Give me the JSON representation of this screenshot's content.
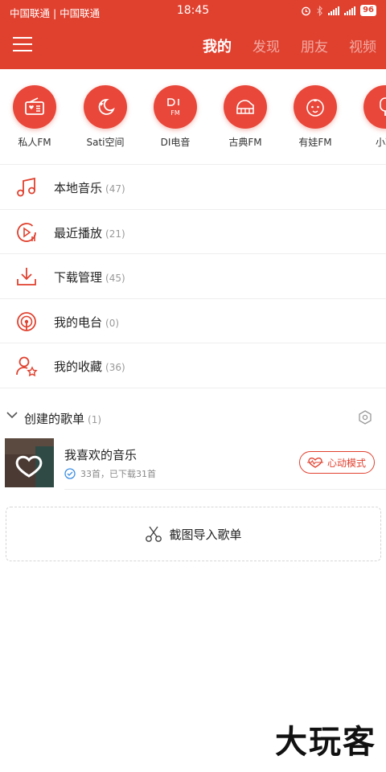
{
  "status": {
    "carrier": "中国联通 | 中国联通",
    "time": "18:45",
    "battery": "96"
  },
  "header": {
    "tabs": [
      "我的",
      "发现",
      "朋友",
      "视频"
    ],
    "active_tab": "我的"
  },
  "quick": [
    {
      "label": "私人FM",
      "icon": "radio-icon"
    },
    {
      "label": "Sati空间",
      "icon": "moon-icon"
    },
    {
      "label": "DI电音",
      "icon": "di-fm-icon"
    },
    {
      "label": "古典FM",
      "icon": "piano-icon"
    },
    {
      "label": "有娃FM",
      "icon": "baby-icon"
    },
    {
      "label": "小冰",
      "icon": "popsicle-icon"
    }
  ],
  "menu": [
    {
      "label": "本地音乐",
      "count": "(47)",
      "icon": "music-note-icon"
    },
    {
      "label": "最近播放",
      "count": "(21)",
      "icon": "recent-play-icon"
    },
    {
      "label": "下载管理",
      "count": "(45)",
      "icon": "download-icon"
    },
    {
      "label": "我的电台",
      "count": "(0)",
      "icon": "radio-station-icon"
    },
    {
      "label": "我的收藏",
      "count": "(36)",
      "icon": "favorite-user-icon"
    }
  ],
  "section": {
    "title": "创建的歌单",
    "count": "(1)"
  },
  "playlist": {
    "title": "我喜欢的音乐",
    "subtitle": "33首，已下载31首",
    "heart_mode": "心动模式"
  },
  "import": {
    "label": "截图导入歌单"
  },
  "watermark": "大玩客",
  "colors": {
    "accent": "#e0412f"
  }
}
